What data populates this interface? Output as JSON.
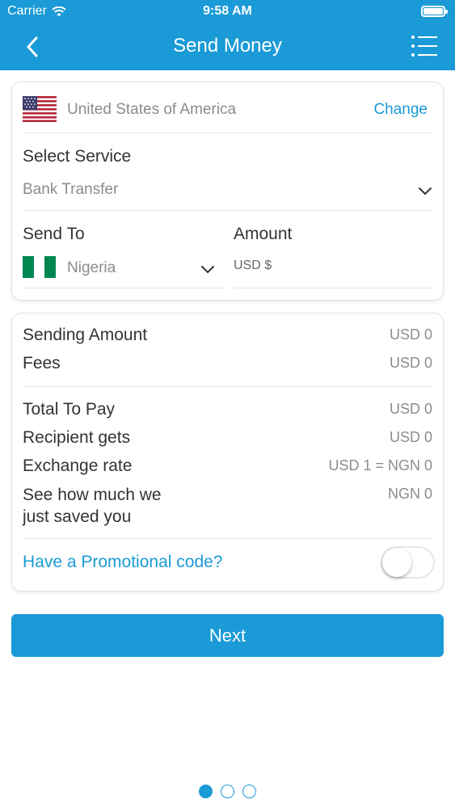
{
  "status_bar": {
    "carrier": "Carrier",
    "time": "9:58 AM"
  },
  "header": {
    "title": "Send Money",
    "back_icon": "chevron-left-icon",
    "menu_icon": "list-menu-icon"
  },
  "origin": {
    "country": "United States of America",
    "change_label": "Change",
    "flag_icon": "us-flag-icon"
  },
  "service": {
    "label": "Select Service",
    "selected": "Bank Transfer"
  },
  "send_to": {
    "label": "Send To",
    "selected": "Nigeria",
    "flag_icon": "nigeria-flag-icon"
  },
  "amount": {
    "label": "Amount",
    "placeholder": "USD $"
  },
  "summary": {
    "sending_amount": {
      "label": "Sending Amount",
      "value": "USD 0"
    },
    "fees": {
      "label": "Fees",
      "value": "USD 0"
    },
    "total_to_pay": {
      "label": "Total To Pay",
      "value": "USD 0"
    },
    "recipient_gets": {
      "label": "Recipient gets",
      "value": "USD 0"
    },
    "exchange_rate": {
      "label": "Exchange rate",
      "value": "USD 1 = NGN 0"
    },
    "savings": {
      "label_line1": "See how much we",
      "label_line2": "just saved you",
      "value": "NGN 0"
    }
  },
  "promo": {
    "label": "Have a Promotional code?",
    "enabled": false
  },
  "next_button": {
    "label": "Next"
  },
  "pager": {
    "count": 3,
    "active": 1
  },
  "colors": {
    "accent": "#1a9ad6",
    "muted_text": "#8c8c8c"
  }
}
